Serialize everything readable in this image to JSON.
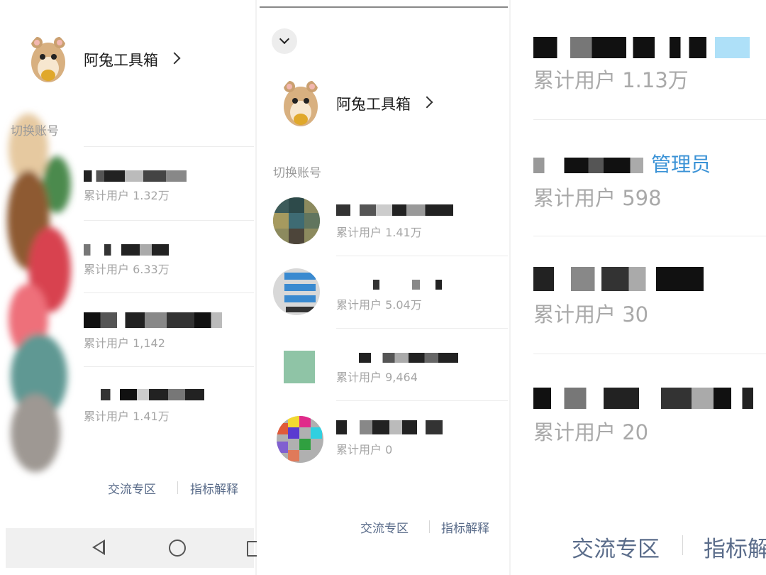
{
  "panel1": {
    "app_name": "阿兔工具箱",
    "switch_label": "切换账号",
    "accounts": [
      {
        "users": "累计用户 1.32万"
      },
      {
        "users": "累计用户 6.33万"
      },
      {
        "users": "累计用户 1,142"
      },
      {
        "users": "累计用户 1.41万"
      }
    ],
    "footer": {
      "community": "交流专区",
      "metrics": "指标解释"
    }
  },
  "panel2": {
    "app_name": "阿兔工具箱",
    "switch_label": "切换账号",
    "accounts": [
      {
        "users": "累计用户 1.41万"
      },
      {
        "users": "累计用户 5.04万"
      },
      {
        "users": "累计用户 9,464"
      },
      {
        "users": "累计用户 0"
      }
    ],
    "footer": {
      "community": "交流专区",
      "metrics": "指标解释"
    }
  },
  "panel3": {
    "accounts": [
      {
        "users": "累计用户 1.13万"
      },
      {
        "users": "累计用户 598",
        "badge": "管理员"
      },
      {
        "users": "累计用户 30"
      },
      {
        "users": "累计用户 20"
      }
    ],
    "footer": {
      "community": "交流专区",
      "metrics": "指标解"
    }
  },
  "icons": {
    "collapse": "chevron-down-icon",
    "profile_more": "chevron-right-icon",
    "nav_back": "back-triangle-icon",
    "nav_home": "home-circle-icon",
    "nav_recent": "recent-square-icon"
  },
  "colors": {
    "admin_badge": "#3a92d6",
    "footer_link": "#5a6c8a",
    "secondary_text": "#a5a5a5"
  }
}
